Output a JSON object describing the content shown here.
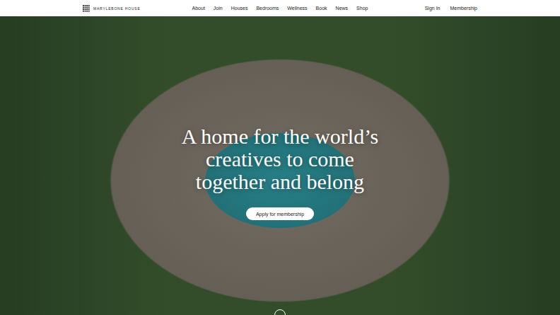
{
  "nav": {
    "logo": "MARYLEBONE HOUSE",
    "links": [
      "About",
      "Join",
      "Houses",
      "Bedrooms",
      "Wellness",
      "Book",
      "News",
      "Shop"
    ],
    "account_links": [
      "Sign In",
      "Membership"
    ]
  },
  "hero": {
    "heading_lines": [
      "A home for the world’s",
      "creatives to come",
      "together and belong"
    ],
    "button": "Apply for membership"
  }
}
